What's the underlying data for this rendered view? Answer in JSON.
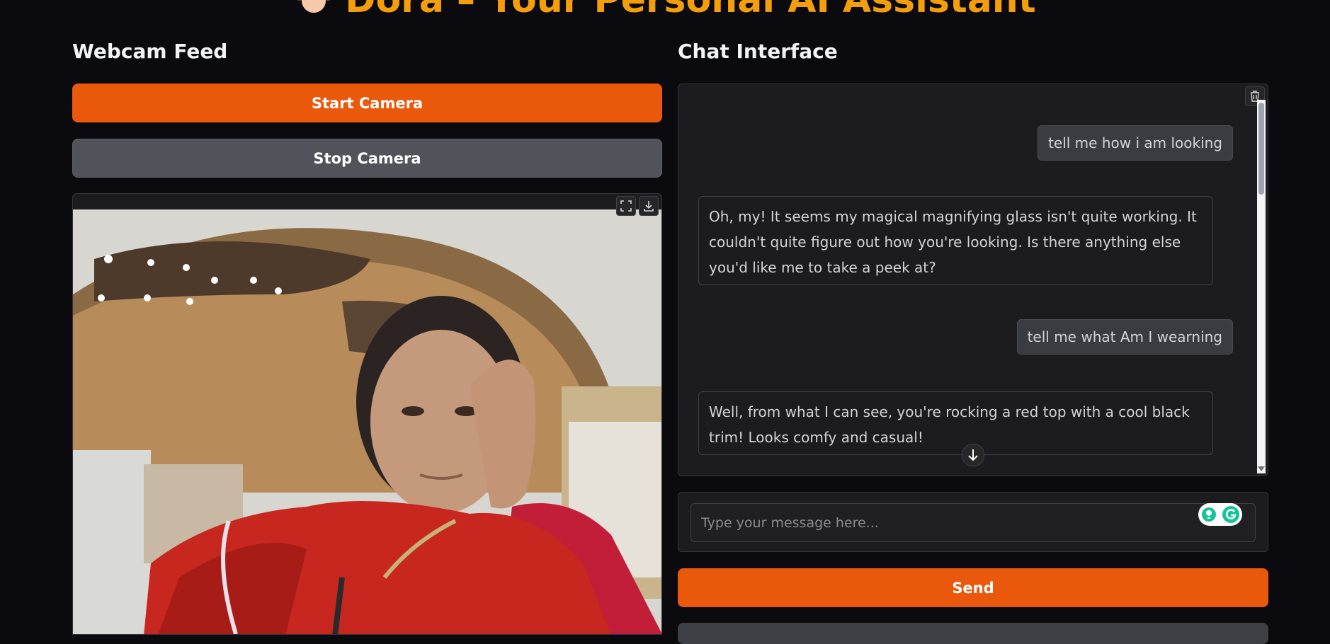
{
  "header": {
    "title": "Dora – Your Personal AI Assistant"
  },
  "webcam": {
    "heading": "Webcam Feed",
    "start_label": "Start Camera",
    "stop_label": "Stop Camera"
  },
  "chat": {
    "heading": "Chat Interface",
    "messages": [
      {
        "role": "user",
        "text": "tell me how i am looking"
      },
      {
        "role": "assistant",
        "text": "Oh, my! It seems my magical magnifying glass isn't quite working. It couldn't quite figure out how you're looking. Is there anything else you'd like me to take a peek at?"
      },
      {
        "role": "user",
        "text": "tell me what Am I wearning"
      },
      {
        "role": "assistant",
        "text": "Well, from what I can see, you're rocking a red top with a cool black trim! Looks comfy and casual!"
      }
    ],
    "input_placeholder": "Type your message here...",
    "send_label": "Send"
  },
  "colors": {
    "accent": "#ea580c",
    "title": "#f59e0b",
    "background": "#0b0b0f"
  }
}
